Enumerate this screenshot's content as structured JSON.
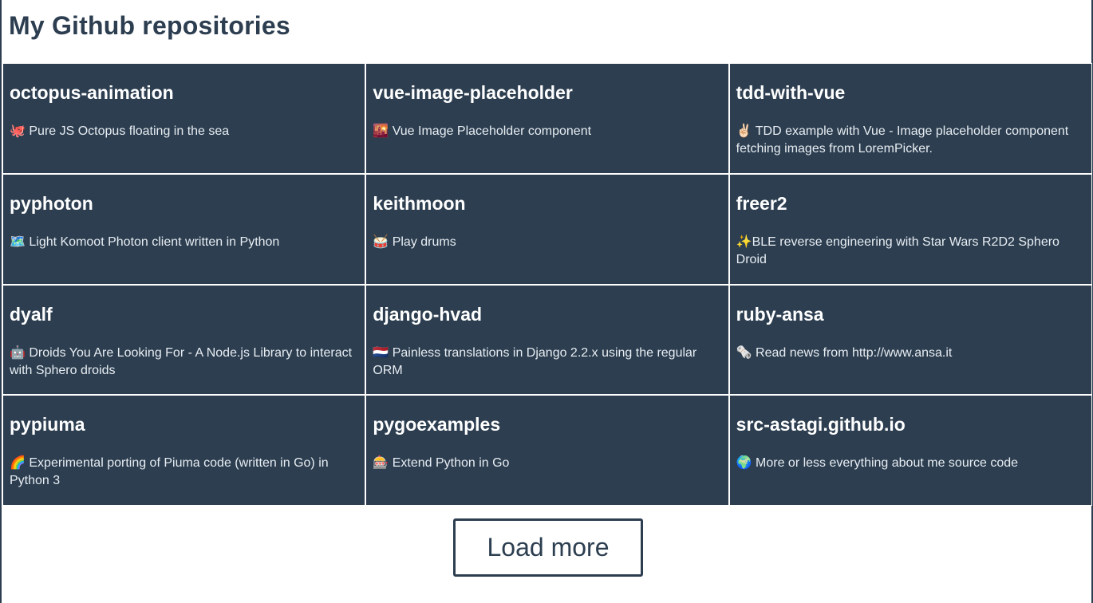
{
  "page": {
    "title": "My Github repositories"
  },
  "repos": [
    {
      "name": "octopus-animation",
      "description": "🐙 Pure JS Octopus floating in the sea"
    },
    {
      "name": "vue-image-placeholder",
      "description": "🌇 Vue Image Placeholder component"
    },
    {
      "name": "tdd-with-vue",
      "description": "✌🏻 TDD example with Vue - Image placeholder component fetching images from LoremPicker."
    },
    {
      "name": "pyphoton",
      "description": "🗺️ Light Komoot Photon client written in Python"
    },
    {
      "name": "keithmoon",
      "description": "🥁 Play drums"
    },
    {
      "name": "freer2",
      "description": "✨BLE reverse engineering with Star Wars R2D2 Sphero Droid"
    },
    {
      "name": "dyalf",
      "description": "🤖 Droids You Are Looking For - A Node.js Library to interact with Sphero droids"
    },
    {
      "name": "django-hvad",
      "description": "🇳🇱 Painless translations in Django 2.2.x using the regular ORM"
    },
    {
      "name": "ruby-ansa",
      "description": "🗞️ Read news from http://www.ansa.it"
    },
    {
      "name": "pypiuma",
      "description": "🌈 Experimental porting of Piuma code (written in Go) in Python 3"
    },
    {
      "name": "pygoexamples",
      "description": "🎰 Extend Python in Go"
    },
    {
      "name": "src-astagi.github.io",
      "description": "🌍 More or less everything about me source code"
    }
  ],
  "actions": {
    "load_more_label": "Load more"
  },
  "colors": {
    "primary": "#2c3e50",
    "card_text": "#ffffff",
    "background": "#ffffff"
  }
}
